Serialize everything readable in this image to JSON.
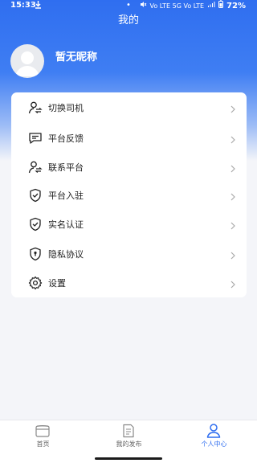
{
  "status_bar": {
    "time": "15:33",
    "download_icon": "download-icon",
    "dot": "•",
    "indicators": "Vo LTE 5G Vo LTE",
    "battery": "72%"
  },
  "header": {
    "title": "我的"
  },
  "profile": {
    "nickname": "暂无昵称"
  },
  "menu": {
    "items": [
      {
        "label": "切换司机",
        "icon": "user-switch-icon"
      },
      {
        "label": "平台反馈",
        "icon": "message-icon"
      },
      {
        "label": "联系平台",
        "icon": "user-switch-icon"
      },
      {
        "label": "平台入驻",
        "icon": "shield-check-icon"
      },
      {
        "label": "实名认证",
        "icon": "shield-check-icon"
      },
      {
        "label": "隐私协议",
        "icon": "lock-shield-icon"
      },
      {
        "label": "设置",
        "icon": "gear-icon"
      }
    ]
  },
  "tabbar": {
    "tabs": [
      {
        "label": "首页",
        "icon": "home-icon"
      },
      {
        "label": "我的发布",
        "icon": "document-icon"
      },
      {
        "label": "个人中心",
        "icon": "person-icon"
      }
    ],
    "active_color": "#2f6ef0"
  }
}
